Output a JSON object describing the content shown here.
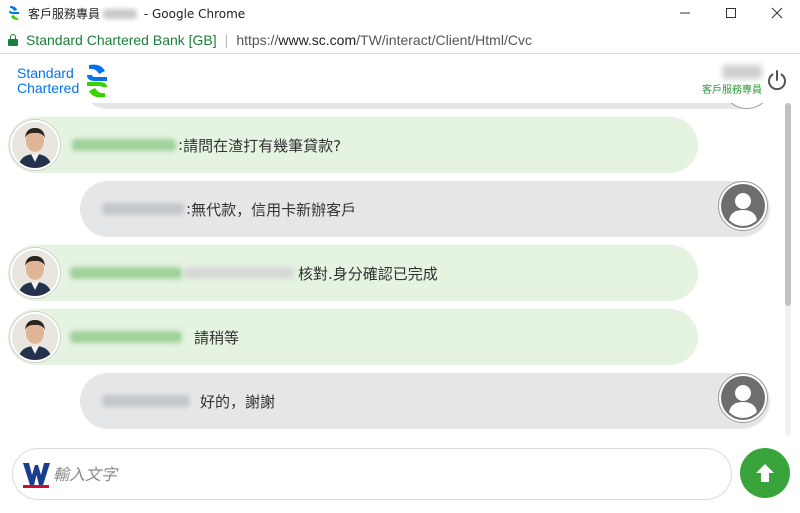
{
  "window": {
    "title_prefix": "客戶服務專員",
    "title_suffix": " - Google Chrome",
    "minimize": "—",
    "maximize": "☐",
    "close": "✕"
  },
  "address": {
    "site_name": "Standard Chartered Bank [GB]",
    "separator": "|",
    "url_scheme": "https://",
    "url_host": "www.sc.com",
    "url_path": "/TW/interact/Client/Html/Cvc"
  },
  "header": {
    "logo_line1": "Standard",
    "logo_line2": "Chartered",
    "agent_label": "客戶服務專員",
    "brand_blue": "#0473ea",
    "brand_green": "#38d200"
  },
  "messages": [
    {
      "sender": "agent",
      "prefix": ": ",
      "text": "請問在渣打有幾筆貸款?"
    },
    {
      "sender": "customer",
      "prefix": ": ",
      "text": "無代款，信用卡新辦客戶"
    },
    {
      "sender": "agent",
      "prefix": "",
      "text": "核對.身分確認已完成"
    },
    {
      "sender": "agent",
      "prefix": "",
      "text": "請稍等"
    },
    {
      "sender": "customer",
      "prefix": "",
      "text": "好的，謝謝"
    }
  ],
  "input": {
    "placeholder": "輸入文字"
  },
  "colors": {
    "agent_bubble": "#e5f3e1",
    "customer_bubble": "#e4e6e8",
    "send_button": "#3aa43c",
    "secure_green": "#1b7f3a"
  },
  "icons": {
    "app": "standard-chartered-icon",
    "lock": "lock-icon",
    "power": "power-icon",
    "send": "arrow-up-icon",
    "customer_avatar": "user-silhouette-icon",
    "agent_avatar": "agent-photo"
  }
}
